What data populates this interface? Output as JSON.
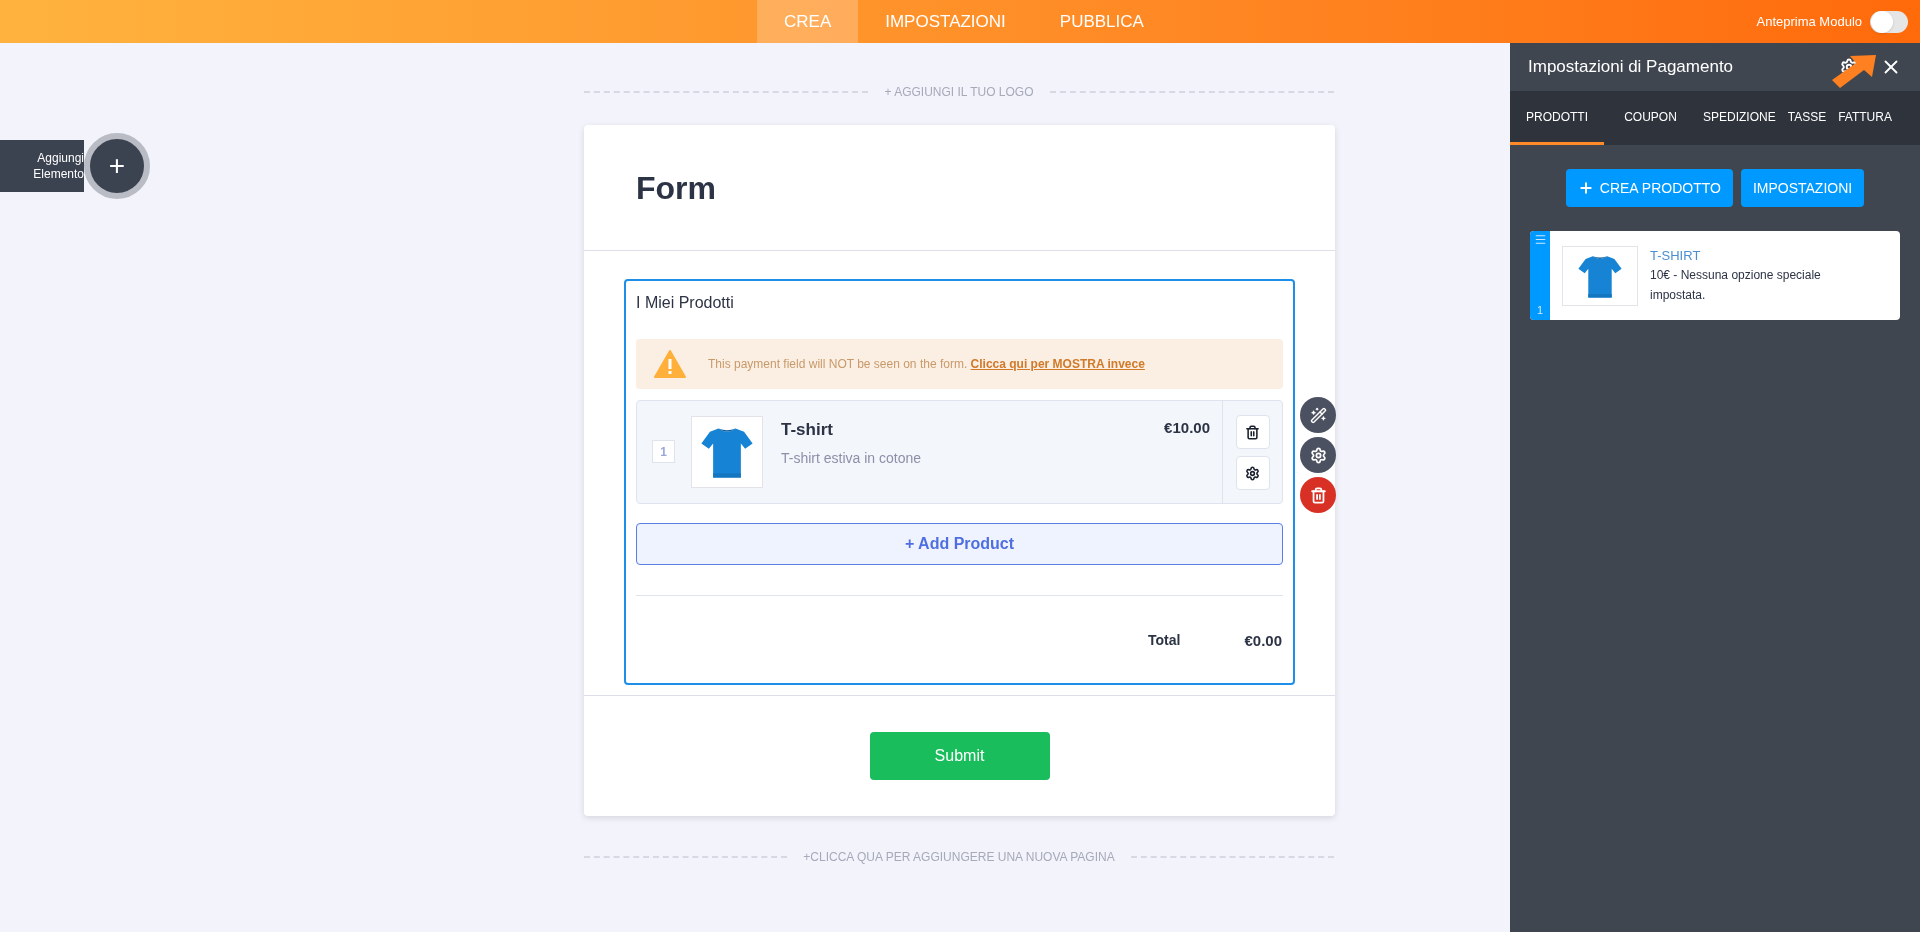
{
  "topbar": {
    "tabs": [
      {
        "label": "CREA",
        "selected": true
      },
      {
        "label": "IMPOSTAZIONI",
        "selected": false
      },
      {
        "label": "PUBBLICA",
        "selected": false
      }
    ],
    "preview": {
      "label": "Anteprima Modulo",
      "on": false
    }
  },
  "add_element": {
    "label": "Aggiungi Elemento",
    "icon": "+"
  },
  "canvas": {
    "logo_hint": "+ AGGIUNGI IL TUO LOGO",
    "new_page_hint": "+CLICCA QUA PER AGGIUNGERE UNA NUOVA PAGINA"
  },
  "form": {
    "title": "Form",
    "field": {
      "label": "I Miei Prodotti",
      "warning": {
        "text": "This payment field will NOT be seen on the form.",
        "link": "Clicca qui per MOSTRA invece"
      },
      "products": [
        {
          "index": "1",
          "name": "T-shirt",
          "description": "T-shirt estiva in cotone",
          "price": "€10.00"
        }
      ],
      "add_button": "+ Add Product",
      "total_label": "Total",
      "total_value": "€0.00"
    },
    "submit": "Submit"
  },
  "panel": {
    "title": "Impostazioni di Pagamento",
    "tabs": [
      {
        "label": "PRODOTTI",
        "selected": true
      },
      {
        "label": "COUPON",
        "selected": false
      },
      {
        "label": "SPEDIZIONE",
        "selected": false
      },
      {
        "label": "TASSE",
        "selected": false
      },
      {
        "label": "FATTURA",
        "selected": false
      }
    ],
    "buttons": [
      {
        "label": "CREA PRODOTTO",
        "kind": "create"
      },
      {
        "label": "IMPOSTAZIONI",
        "kind": "plain"
      }
    ],
    "products": [
      {
        "index": "1",
        "name": "T-SHIRT",
        "details": "10€ - Nessuna opzione speciale impostata."
      }
    ]
  }
}
